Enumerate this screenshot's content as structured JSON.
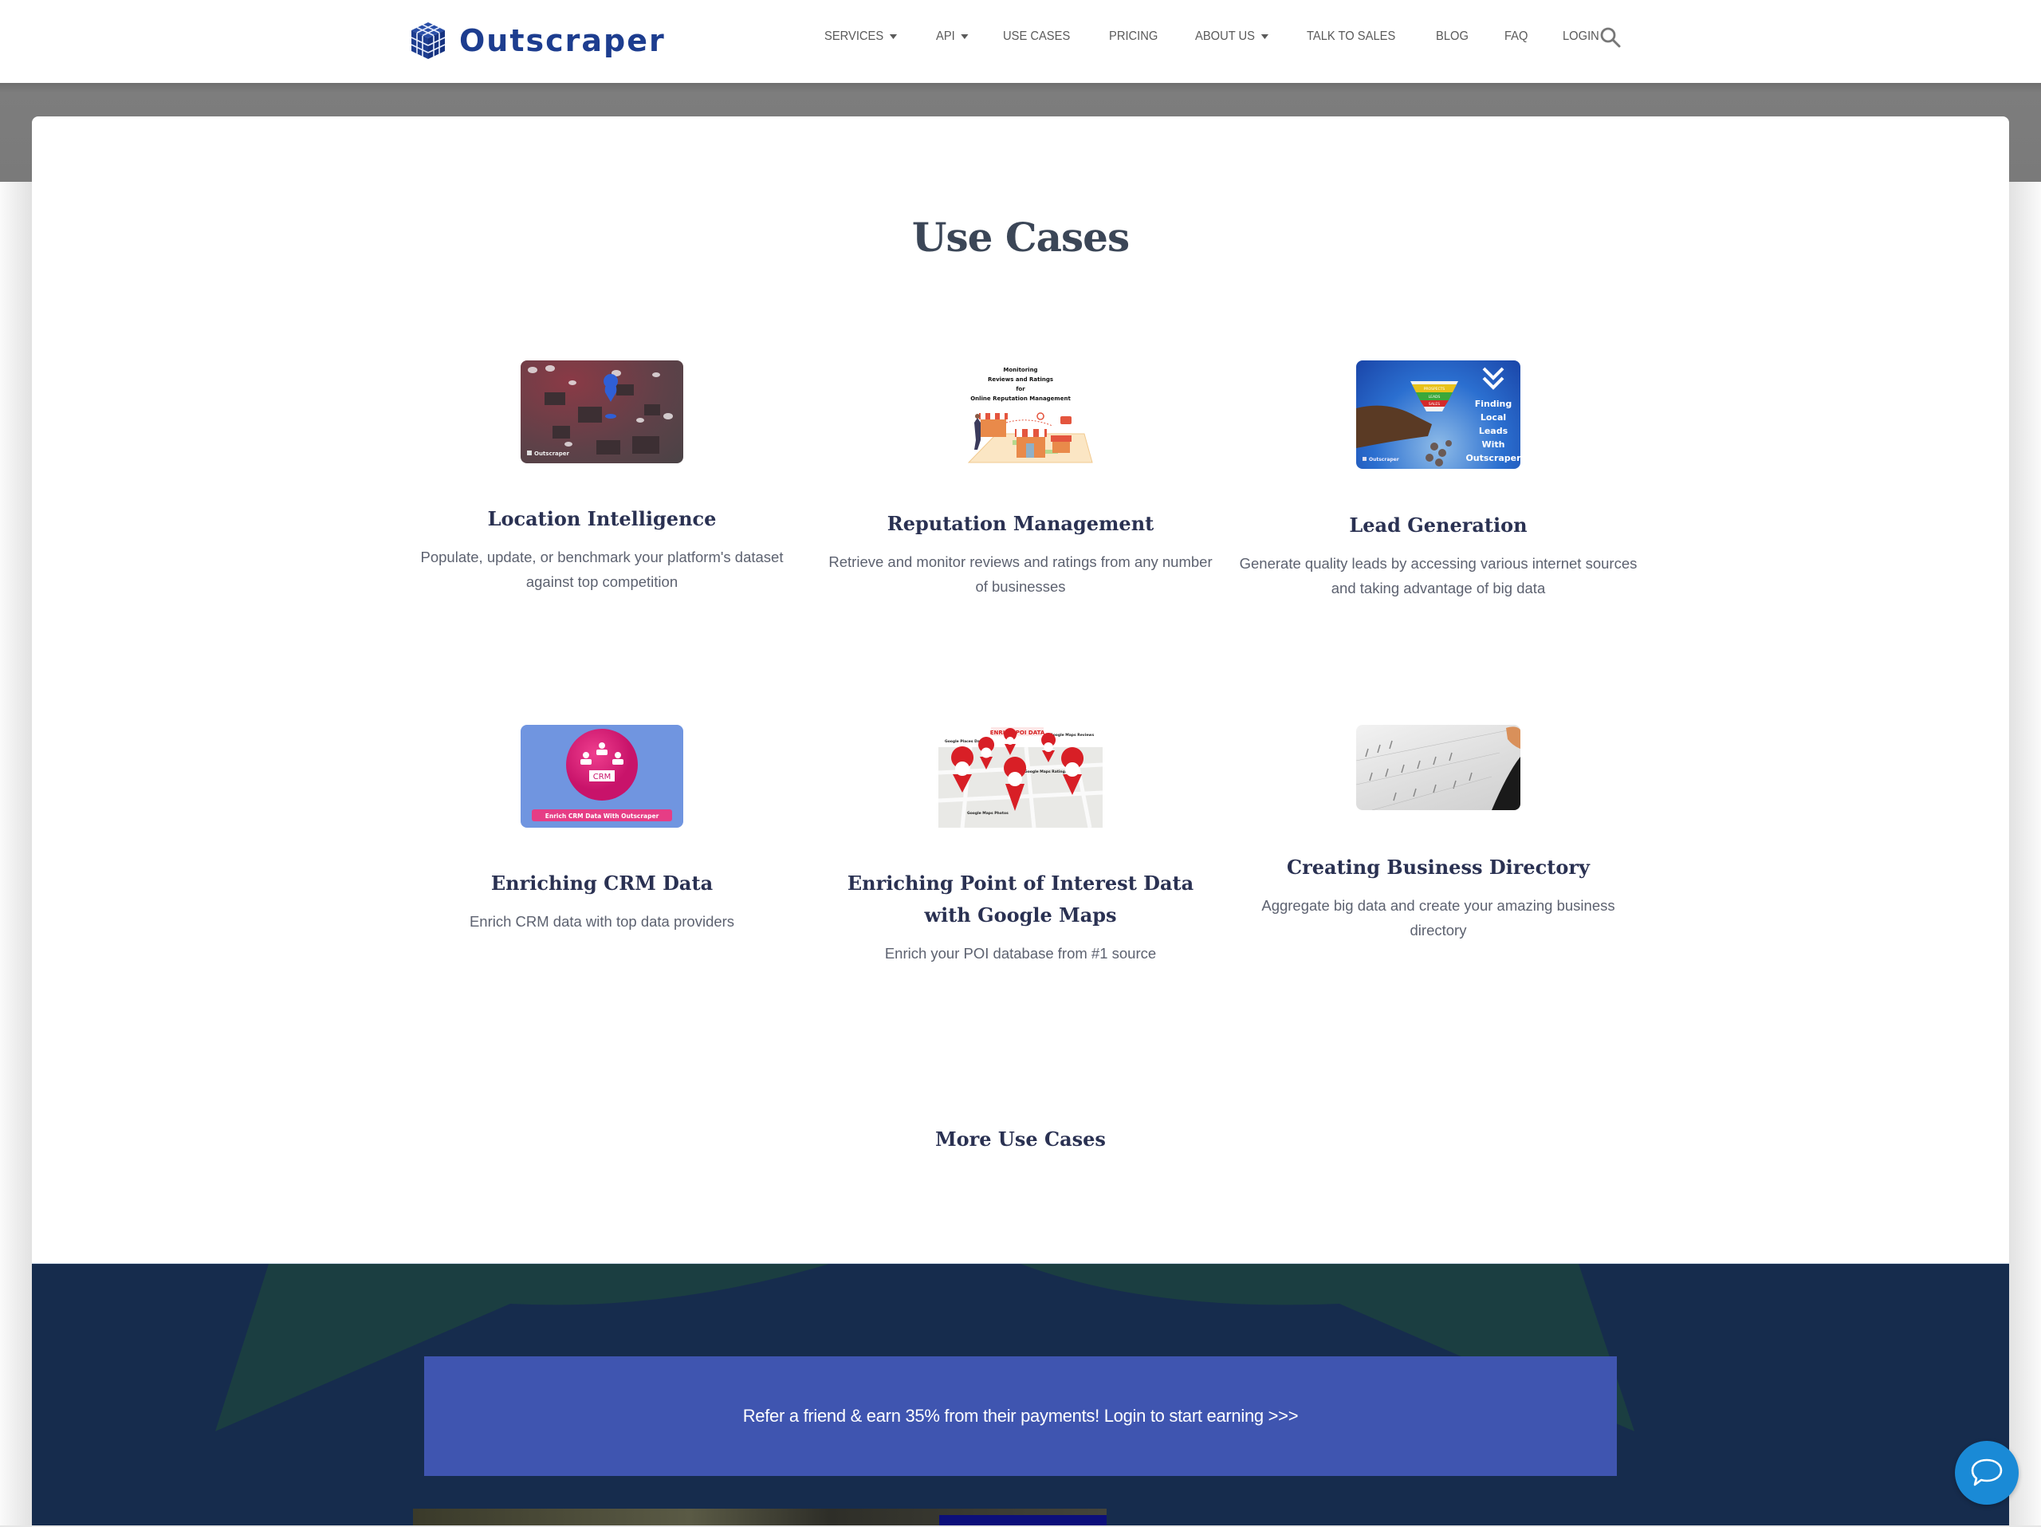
{
  "header": {
    "brand": "Outscraper",
    "nav": [
      {
        "label": "SERVICES",
        "dropdown": true
      },
      {
        "label": "API",
        "dropdown": true
      },
      {
        "label": "USE CASES",
        "dropdown": false
      },
      {
        "label": "PRICING",
        "dropdown": false
      },
      {
        "label": "ABOUT US",
        "dropdown": true
      },
      {
        "label": "TALK TO SALES",
        "dropdown": false
      },
      {
        "label": "BLOG",
        "dropdown": false
      },
      {
        "label": "FAQ",
        "dropdown": false
      },
      {
        "label": "LOGIN",
        "dropdown": false
      }
    ],
    "search_icon": "search-icon"
  },
  "main": {
    "title": "Use Cases",
    "cards": [
      {
        "title": "Location Intelligence",
        "description": "Populate, update, or benchmark your platform's dataset against top competition",
        "image": {
          "subject": "3D blocks with location pin",
          "caption": "Outscraper"
        }
      },
      {
        "title": "Reputation Management",
        "description": "Retrieve and monitor reviews and ratings from any number of businesses",
        "image": {
          "subject": "storefronts on a map",
          "lines": [
            "Monitoring",
            "Reviews and Ratings",
            "for",
            "Online Reputation Management"
          ]
        }
      },
      {
        "title": "Lead Generation",
        "description": "Generate quality leads by accessing various internet sources and taking advantage of big data",
        "image": {
          "subject": "sales funnel",
          "funnel": [
            "PROSPECTS",
            "LEADS",
            "SALES"
          ],
          "lines": [
            "Finding",
            "Local",
            "Leads",
            "With",
            "Outscraper"
          ],
          "caption": "Outscraper"
        }
      },
      {
        "title": "Enriching CRM Data",
        "description": "Enrich CRM data with top data providers",
        "image": {
          "subject": "CRM badge",
          "badge": "CRM",
          "caption": "Enrich CRM Data With Outscraper"
        }
      },
      {
        "title": "Enriching Point of Interest Data with Google Maps",
        "description": "Enrich your POI database from #1 source",
        "image": {
          "subject": "map pins",
          "heading": "ENRICH POI DATA",
          "labels": [
            "Google Places Data",
            "Google Maps Reviews",
            "Google Maps Ratings",
            "Google Maps Photos"
          ]
        }
      },
      {
        "title": "Creating Business Directory",
        "description": "Aggregate big data and create your amazing business directory",
        "image": {
          "subject": "printed directory pages"
        }
      }
    ],
    "more_link": "More Use Cases"
  },
  "footer": {
    "referral_text": "Refer a friend & earn 35% from their payments! Login to start earning >>>"
  },
  "chat": {
    "icon": "chat-bubble-icon"
  },
  "colors": {
    "brand": "#1d3d8f",
    "heading": "#2a3152",
    "footer_bg": "#162c4d",
    "referral_bg": "#3f55b0",
    "chat": "#1a8ad6"
  }
}
